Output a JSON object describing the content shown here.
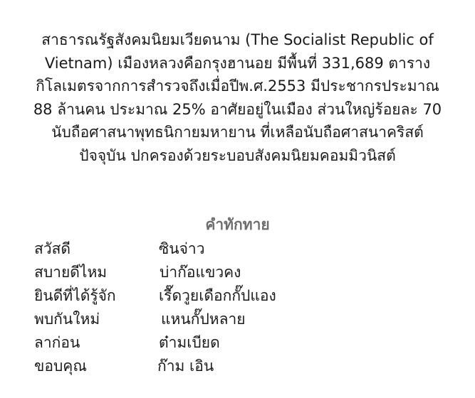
{
  "intro": {
    "lines": [
      "สาธารณรัฐสังคมนิยมเวียดนาม (The Socialist Republic of",
      "Vietnam) เมืองหลวงคือกรุงฮานอย มีพื้นที่ 331,689 ตาราง",
      "กิโลเมตรจากการสำรวจถึงเมื่อปีพ.ศ.2553 มีประชากรประมาณ",
      "88 ล้านคน ประมาณ 25% อาศัยอยู่ในเมือง ส่วนใหญ่ร้อยละ 70",
      "นับถือศาสนาพุทธนิกายมหายาน ที่เหลือนับถือศาสนาคริสต์",
      "ปัจจุบัน ปกครองด้วยระบอบสังคมนิยมคอมมิวนิสต์"
    ]
  },
  "greetings": {
    "title": "คำทักทาย",
    "rows": [
      {
        "thai": "สวัสดี",
        "viet": "ซินจ่าว"
      },
      {
        "thai": "สบายดีไหม",
        "viet": "บ่าก๊อแขวคง"
      },
      {
        "thai": "ยินดีที่ได้รู้จัก",
        "viet": "เรื๊ดวูยเดือกกั๊ปแอง"
      },
      {
        "thai": "พบกันใหม่",
        "viet": "แหนกั๊ปหลาย"
      },
      {
        "thai": "ลาก่อน",
        "viet": "ต๋ามเบียด"
      },
      {
        "thai": "ขอบคุณ",
        "viet": "ก๊าม เอิน"
      }
    ]
  }
}
